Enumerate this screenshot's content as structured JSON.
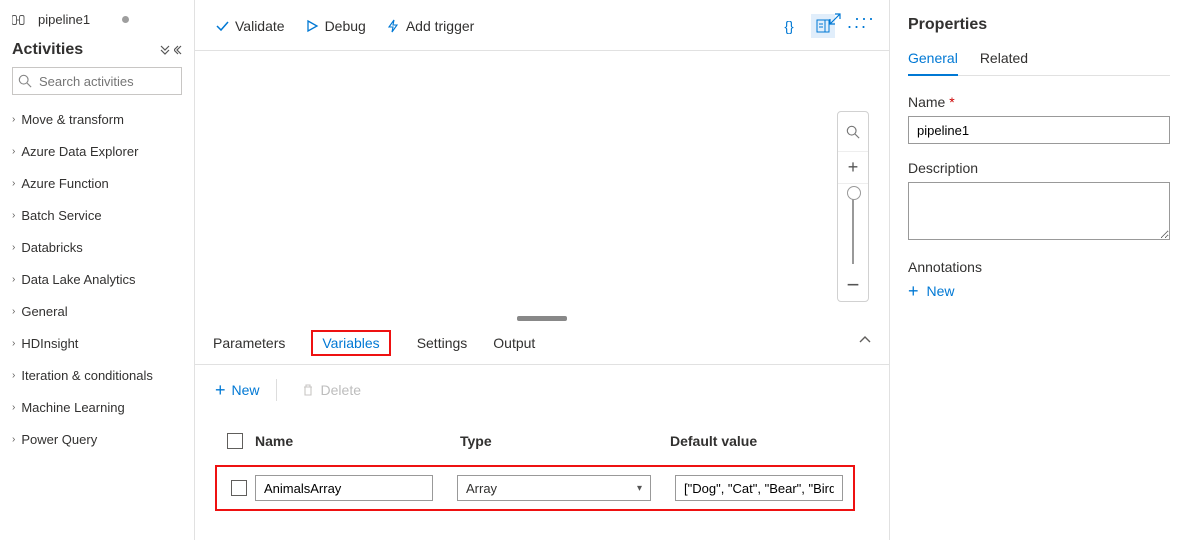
{
  "titlebar": {
    "pipeline_name": "pipeline1"
  },
  "activities": {
    "title": "Activities",
    "search_placeholder": "Search activities",
    "items": [
      "Move & transform",
      "Azure Data Explorer",
      "Azure Function",
      "Batch Service",
      "Databricks",
      "Data Lake Analytics",
      "General",
      "HDInsight",
      "Iteration & conditionals",
      "Machine Learning",
      "Power Query"
    ]
  },
  "toolbar": {
    "validate": "Validate",
    "debug": "Debug",
    "add_trigger": "Add trigger"
  },
  "bottom_tabs": {
    "parameters": "Parameters",
    "variables": "Variables",
    "settings": "Settings",
    "output": "Output"
  },
  "variables": {
    "new_label": "New",
    "delete_label": "Delete",
    "headers": {
      "name": "Name",
      "type": "Type",
      "default": "Default value"
    },
    "rows": [
      {
        "name": "AnimalsArray",
        "type": "Array",
        "default": "[\"Dog\", \"Cat\", \"Bear\", \"Bird\"]"
      }
    ]
  },
  "properties": {
    "title": "Properties",
    "tabs": {
      "general": "General",
      "related": "Related"
    },
    "name_label": "Name",
    "name_value": "pipeline1",
    "description_label": "Description",
    "annotations_label": "Annotations",
    "annotations_new": "New"
  }
}
